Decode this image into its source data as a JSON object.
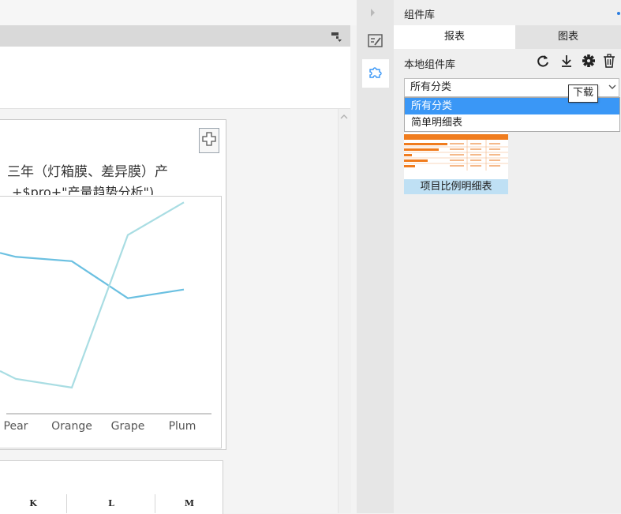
{
  "panel": {
    "title": "组件库",
    "tabs": [
      {
        "label": "报表",
        "active": true
      },
      {
        "label": "图表",
        "active": false
      }
    ],
    "library_label": "本地组件库",
    "select_value": "所有分类",
    "tooltip": "下载",
    "options": [
      {
        "label": "所有分类",
        "selected": true
      },
      {
        "label": "简单明细表",
        "selected": false
      }
    ],
    "widget_label": "项目比例明细表"
  },
  "chart_title": "三年（灯箱膜、差异膜）产",
  "chart_formula": "+$pro+\"产量趋势分析\")",
  "chart_data": {
    "type": "line",
    "categories": [
      "Pear",
      "Orange",
      "Grape",
      "Plum"
    ],
    "series": [
      {
        "values": [
          72,
          70,
          53,
          57
        ],
        "color": "#6bc0e1"
      },
      {
        "values": [
          16,
          12,
          82,
          97
        ],
        "color": "#a9dde3"
      }
    ],
    "ylim": [
      0,
      100
    ],
    "grid": false
  },
  "table_headers": [
    "K",
    "L",
    "M"
  ],
  "colors": {
    "accent": "#3a97f6",
    "thumb": "#f07c1e",
    "selection": "#bfe0f4"
  }
}
